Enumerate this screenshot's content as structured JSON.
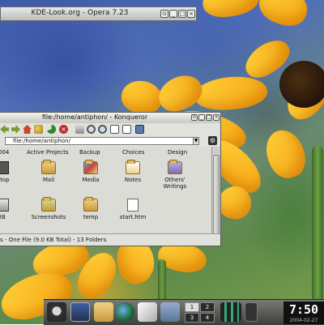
{
  "opera": {
    "title": "KDE-Look.org - Opera 7.23"
  },
  "konqueror": {
    "title": "file:/home/antiphon/ - Konqueror",
    "location": "file:/home/antiphon/",
    "status": "s - One File (9.0 KB Total) - 13 Folders",
    "header_items": [
      "004",
      "Active Projects",
      "Backup",
      "Choices",
      "Design"
    ],
    "items": [
      {
        "label": "sktop",
        "icon": "folder-desktop-icon"
      },
      {
        "label": "Mail",
        "icon": "folder-mail-icon"
      },
      {
        "label": "Media",
        "icon": "folder-media-icon"
      },
      {
        "label": "Notes",
        "icon": "folder-notes-icon"
      },
      {
        "label": "Others' Writings",
        "icon": "folder-writings-icon"
      },
      {
        "label": "RB",
        "icon": "folder-rb-icon"
      },
      {
        "label": "Screenshots",
        "icon": "folder-screenshots-icon"
      },
      {
        "label": "temp",
        "icon": "folder-icon"
      },
      {
        "label": "start.htm",
        "icon": "html-file-icon"
      }
    ]
  },
  "taskbar": {
    "pager": [
      "1",
      "2",
      "3",
      "4"
    ],
    "time": "7:50",
    "date": "2004-02-27"
  },
  "colors": {
    "accent": "#ffd23a",
    "titlebar": "#c8c8c2",
    "taskbar": "#3e3e3a"
  }
}
